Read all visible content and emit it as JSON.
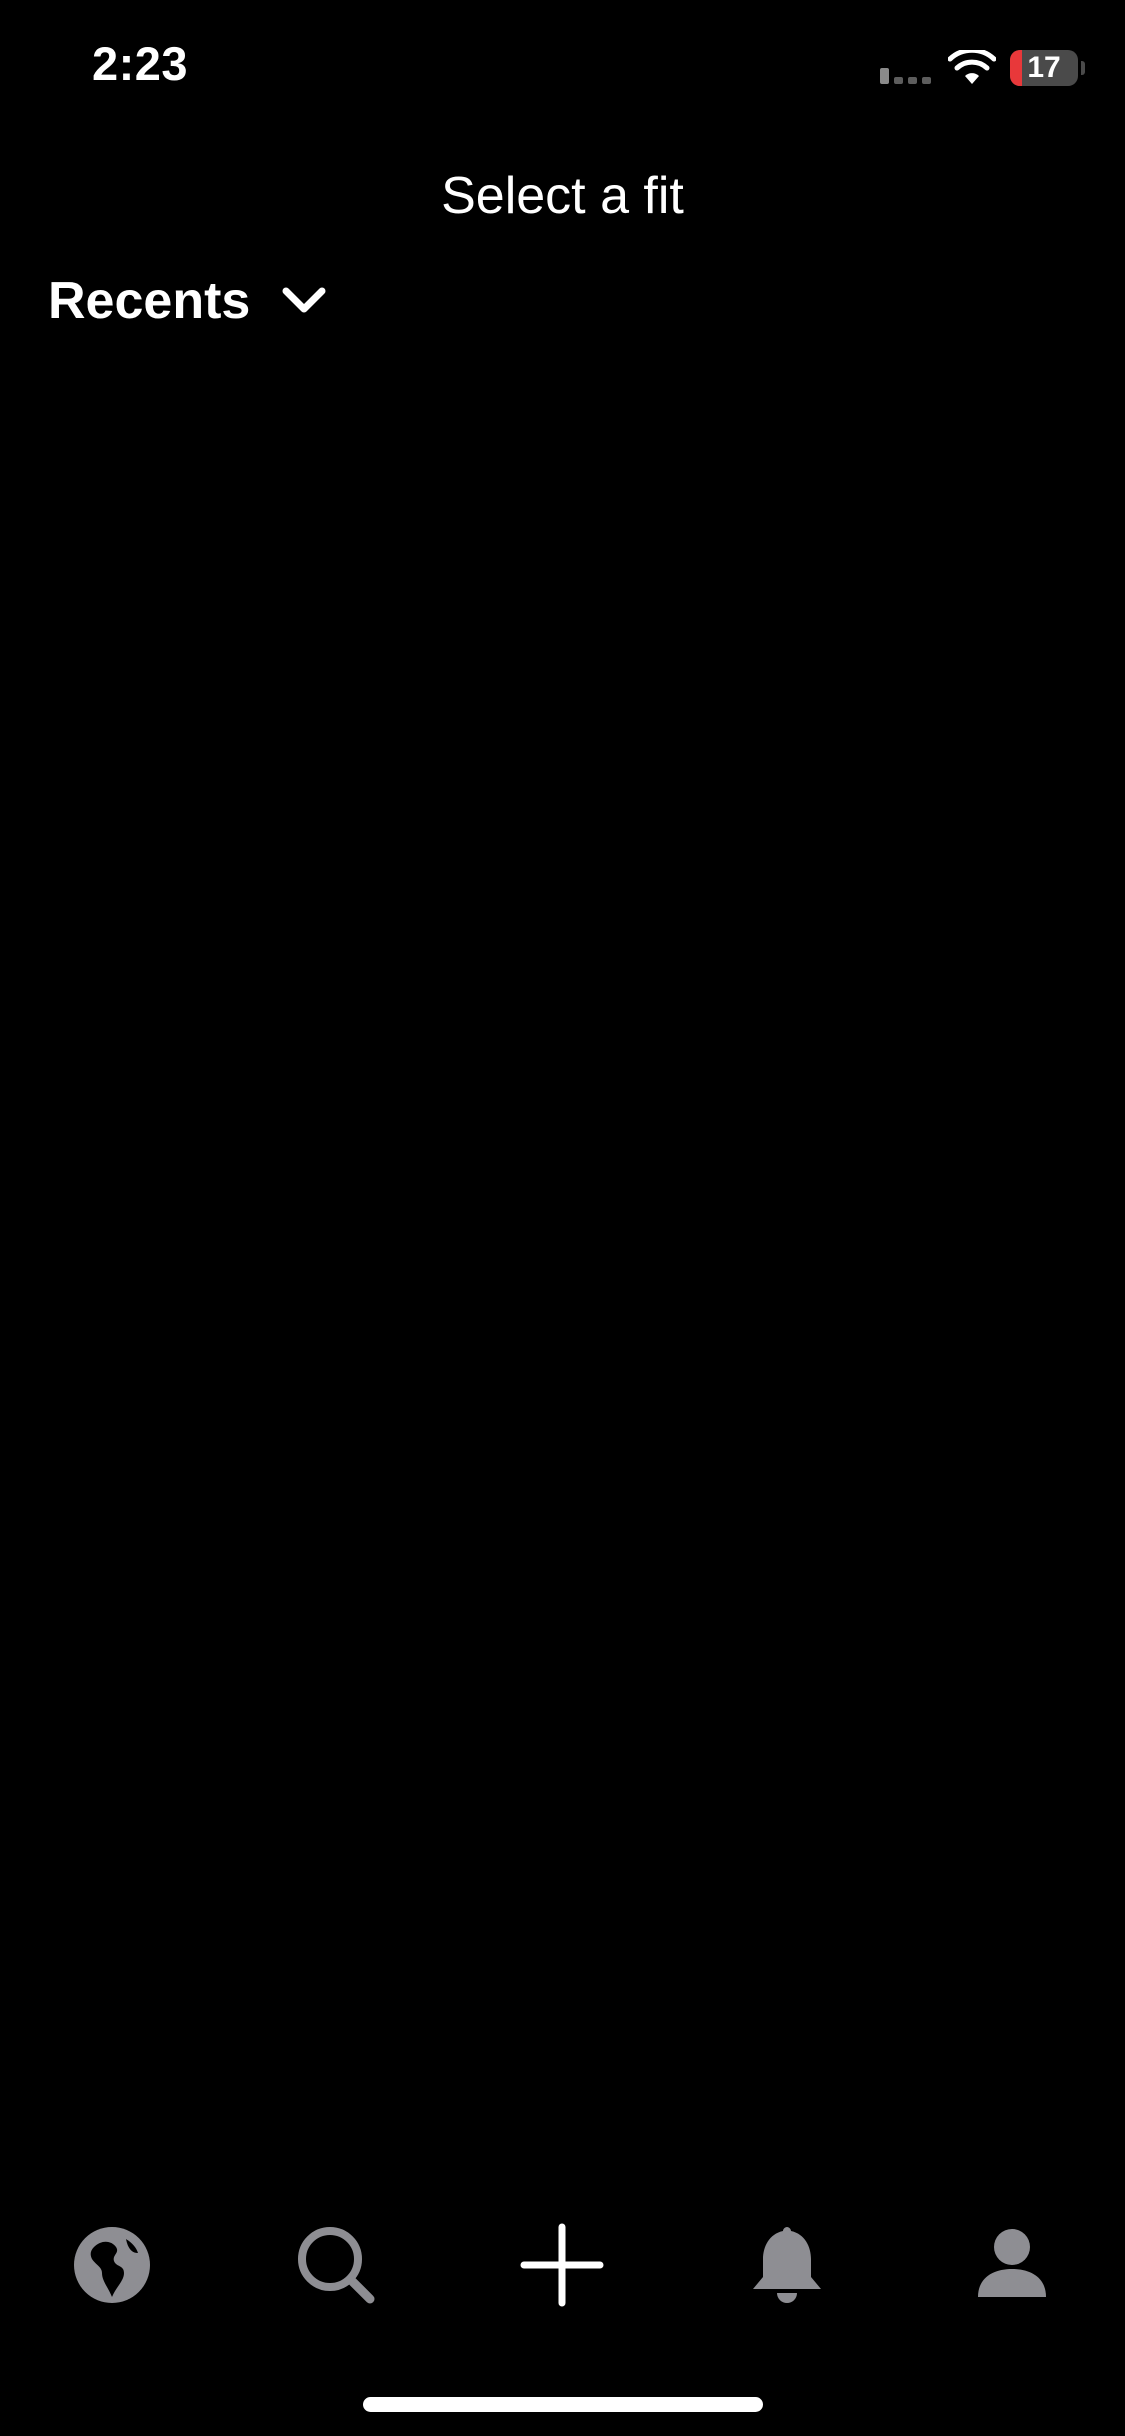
{
  "status_bar": {
    "time": "2:23",
    "battery_level": "17",
    "battery_fraction": 0.17,
    "battery_color": "#e8383a"
  },
  "header": {
    "title": "Select a fit",
    "album_label": "Recents"
  },
  "tab_bar": {
    "items": [
      {
        "icon": "globe-icon",
        "active": false
      },
      {
        "icon": "search-icon",
        "active": false
      },
      {
        "icon": "plus-icon",
        "active": true
      },
      {
        "icon": "bell-icon",
        "active": false
      },
      {
        "icon": "person-icon",
        "active": false
      }
    ],
    "active_color": "#ffffff",
    "inactive_color": "#8e8e93"
  },
  "theme": {
    "background": "#000000",
    "text": "#ffffff"
  }
}
